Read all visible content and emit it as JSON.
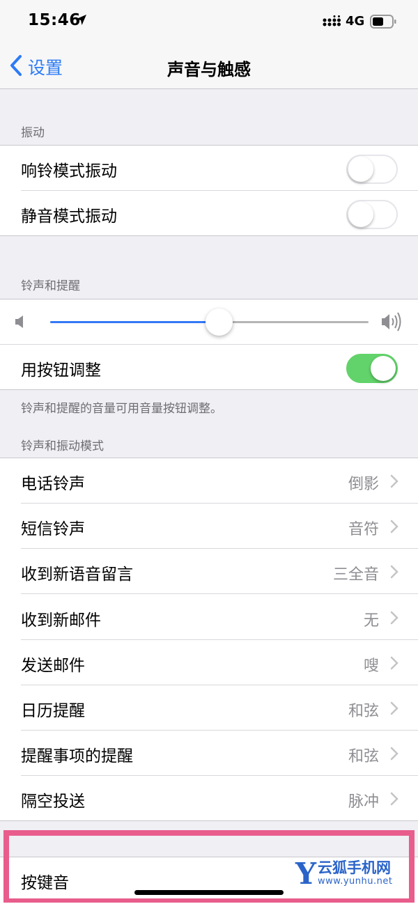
{
  "status_bar": {
    "time": "15:46",
    "network": "4G",
    "location_icon": "location-arrow-icon",
    "signal_icon": "cellular-signal-icon",
    "battery_icon": "battery-icon"
  },
  "nav": {
    "back_label": "设置",
    "title": "声音与触感"
  },
  "vibration": {
    "header": "振动",
    "rows": [
      {
        "label": "响铃模式振动",
        "on": false
      },
      {
        "label": "静音模式振动",
        "on": false
      }
    ]
  },
  "ringer": {
    "header": "铃声和提醒",
    "volume_fraction": 0.53,
    "adjust_label": "用按钮调整",
    "adjust_on": true,
    "footer": "铃声和提醒的音量可用音量按钮调整。"
  },
  "patterns": {
    "header": "铃声和振动模式",
    "rows": [
      {
        "label": "电话铃声",
        "value": "倒影"
      },
      {
        "label": "短信铃声",
        "value": "音符"
      },
      {
        "label": "收到新语音留言",
        "value": "三全音"
      },
      {
        "label": "收到新邮件",
        "value": "无"
      },
      {
        "label": "发送邮件",
        "value": "嗖"
      },
      {
        "label": "日历提醒",
        "value": "和弦"
      },
      {
        "label": "提醒事项的提醒",
        "value": "和弦"
      },
      {
        "label": "隔空投送",
        "value": "脉冲"
      }
    ]
  },
  "keyboard": {
    "label": "按键音"
  },
  "watermark": {
    "logo_letter": "Y",
    "name": "云狐手机网",
    "url": "www.yunhu.net"
  },
  "colors": {
    "accent": "#2d7bf6",
    "switch_on": "#62d36a",
    "highlight": "#e85d8c",
    "background": "#efeff4"
  }
}
